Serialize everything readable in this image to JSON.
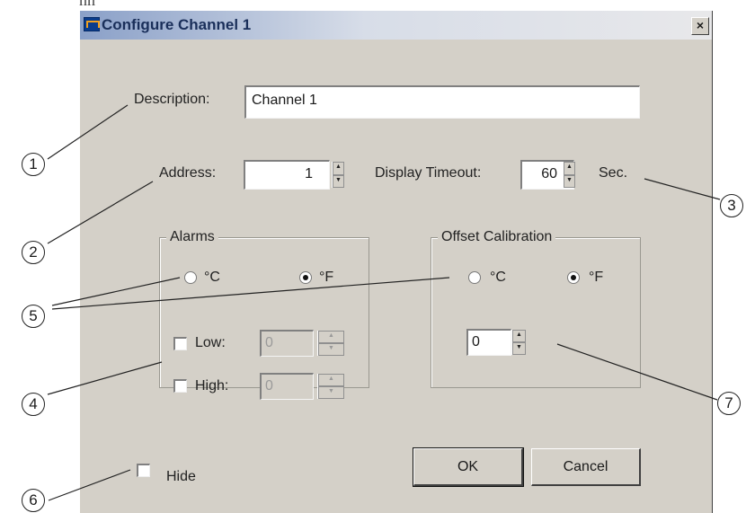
{
  "window": {
    "title": "Configure Channel 1",
    "close_glyph": "×"
  },
  "fields": {
    "description_label": "Description:",
    "description_value": "Channel 1",
    "address_label": "Address:",
    "address_value": "1",
    "display_timeout_label": "Display Timeout:",
    "display_timeout_value": "60",
    "display_timeout_unit": "Sec."
  },
  "alarms": {
    "title": "Alarms",
    "unit_c": "°C",
    "unit_f": "°F",
    "selected_unit": "°F",
    "low_label": "Low:",
    "low_value": "0",
    "high_label": "High:",
    "high_value": "0"
  },
  "offset_calibration": {
    "title": "Offset Calibration",
    "unit_c": "°C",
    "unit_f": "°F",
    "selected_unit": "°F",
    "value": "0"
  },
  "hide_label": "Hide",
  "buttons": {
    "ok": "OK",
    "cancel": "Cancel"
  },
  "callouts": [
    "1",
    "2",
    "3",
    "4",
    "5",
    "6",
    "7"
  ],
  "edge_text": "nn"
}
